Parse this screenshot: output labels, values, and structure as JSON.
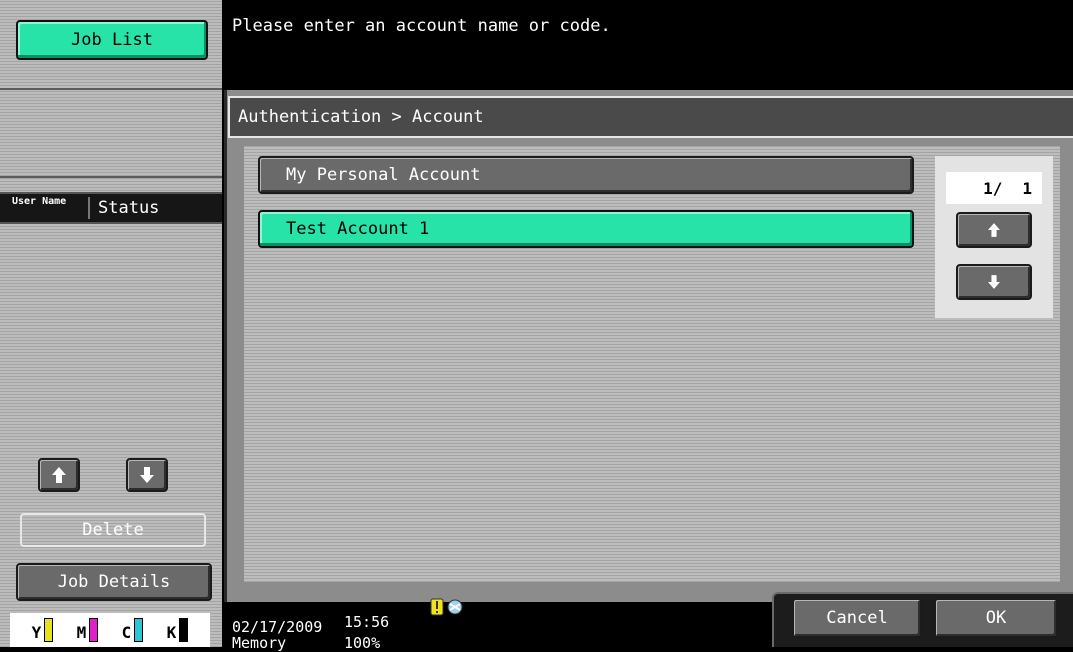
{
  "left_panel": {
    "job_list_label": "Job List",
    "column_user": "User Name",
    "column_status": "Status",
    "up_icon": "arrow-up-icon",
    "down_icon": "arrow-down-icon",
    "delete_label": "Delete",
    "job_details_label": "Job Details",
    "toner": [
      {
        "label": "Y",
        "color": "#e8e21c"
      },
      {
        "label": "M",
        "color": "#e020c8"
      },
      {
        "label": "C",
        "color": "#28c8d8"
      },
      {
        "label": "K",
        "color": "#000000"
      }
    ]
  },
  "header": {
    "message": "Please enter an account name or code."
  },
  "main": {
    "breadcrumb": "Authentication > Account",
    "accounts": [
      {
        "label": "My Personal Account",
        "selected": false
      },
      {
        "label": "Test Account 1",
        "selected": true
      }
    ],
    "pager": {
      "current": "1/",
      "total": "1"
    }
  },
  "status_bar": {
    "date": "02/17/2009",
    "time": "15:56",
    "memory_label": "Memory",
    "memory_value": "100%",
    "icons": [
      "warning-key-icon",
      "network-icon"
    ]
  },
  "actions": {
    "cancel_label": "Cancel",
    "ok_label": "OK"
  },
  "colors": {
    "accent_green": "#27e3a8",
    "button_gray": "#6a6a6a"
  }
}
